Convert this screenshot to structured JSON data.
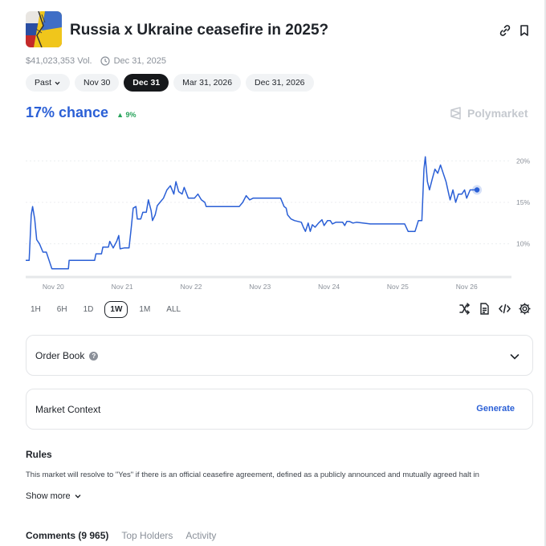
{
  "market": {
    "title": "Russia x Ukraine ceasefire in 2025?",
    "volume": "$41,023,353 Vol.",
    "end_date": "Dec 31, 2025"
  },
  "date_pills": [
    {
      "label": "Past",
      "active": false,
      "dropdown": true
    },
    {
      "label": "Nov 30",
      "active": false
    },
    {
      "label": "Dec 31",
      "active": true
    },
    {
      "label": "Mar 31, 2026",
      "active": false
    },
    {
      "label": "Dec 31, 2026",
      "active": false
    }
  ],
  "odds": {
    "chance": "17% chance",
    "delta": "9%",
    "brand": "Polymarket"
  },
  "chart_data": {
    "type": "line",
    "x_ticks": [
      "Nov 20",
      "Nov 21",
      "Nov 22",
      "Nov 23",
      "Nov 24",
      "Nov 25",
      "Nov 26"
    ],
    "y_ticks": [
      "20%",
      "15%",
      "10%"
    ],
    "ylim": [
      6,
      21
    ],
    "xlim": [
      0,
      7.05
    ],
    "line_color": "#2a5fd6",
    "points": [
      [
        0.0,
        8.0
      ],
      [
        0.05,
        8.0
      ],
      [
        0.08,
        13.5
      ],
      [
        0.1,
        14.5
      ],
      [
        0.13,
        13.0
      ],
      [
        0.16,
        10.5
      ],
      [
        0.2,
        10.0
      ],
      [
        0.25,
        9.0
      ],
      [
        0.3,
        9.0
      ],
      [
        0.38,
        7.0
      ],
      [
        0.55,
        7.0
      ],
      [
        0.62,
        7.0
      ],
      [
        0.63,
        8.0
      ],
      [
        0.9,
        8.0
      ],
      [
        1.0,
        8.0
      ],
      [
        1.02,
        8.8
      ],
      [
        1.1,
        8.8
      ],
      [
        1.12,
        9.6
      ],
      [
        1.2,
        9.6
      ],
      [
        1.22,
        10.3
      ],
      [
        1.27,
        9.5
      ],
      [
        1.32,
        10.3
      ],
      [
        1.35,
        11.0
      ],
      [
        1.37,
        9.4
      ],
      [
        1.43,
        9.5
      ],
      [
        1.5,
        9.5
      ],
      [
        1.53,
        11.8
      ],
      [
        1.56,
        14.3
      ],
      [
        1.6,
        14.5
      ],
      [
        1.62,
        13.0
      ],
      [
        1.67,
        13.0
      ],
      [
        1.7,
        13.8
      ],
      [
        1.75,
        13.8
      ],
      [
        1.78,
        15.3
      ],
      [
        1.82,
        14.0
      ],
      [
        1.84,
        12.8
      ],
      [
        1.88,
        13.5
      ],
      [
        1.91,
        14.6
      ],
      [
        1.95,
        15.0
      ],
      [
        2.0,
        15.5
      ],
      [
        2.05,
        16.5
      ],
      [
        2.1,
        17.0
      ],
      [
        2.15,
        16.0
      ],
      [
        2.18,
        17.5
      ],
      [
        2.22,
        16.3
      ],
      [
        2.27,
        16.0
      ],
      [
        2.3,
        16.8
      ],
      [
        2.36,
        15.5
      ],
      [
        2.45,
        15.5
      ],
      [
        2.5,
        16.0
      ],
      [
        2.55,
        15.3
      ],
      [
        2.6,
        15.0
      ],
      [
        2.62,
        14.5
      ],
      [
        2.8,
        14.5
      ],
      [
        3.1,
        14.5
      ],
      [
        3.15,
        15.0
      ],
      [
        3.2,
        15.8
      ],
      [
        3.25,
        15.3
      ],
      [
        3.3,
        15.5
      ],
      [
        3.35,
        15.5
      ],
      [
        3.7,
        15.5
      ],
      [
        3.75,
        14.5
      ],
      [
        3.78,
        14.3
      ],
      [
        3.8,
        13.5
      ],
      [
        3.85,
        13.0
      ],
      [
        3.9,
        12.8
      ],
      [
        4.0,
        12.6
      ],
      [
        4.03,
        12.0
      ],
      [
        4.06,
        11.5
      ],
      [
        4.1,
        12.5
      ],
      [
        4.13,
        11.5
      ],
      [
        4.16,
        12.3
      ],
      [
        4.2,
        12.0
      ],
      [
        4.25,
        12.5
      ],
      [
        4.3,
        12.9
      ],
      [
        4.33,
        12.2
      ],
      [
        4.38,
        12.8
      ],
      [
        4.42,
        12.8
      ],
      [
        4.45,
        12.4
      ],
      [
        4.5,
        12.6
      ],
      [
        4.6,
        12.6
      ],
      [
        4.63,
        12.2
      ],
      [
        4.66,
        12.7
      ],
      [
        4.7,
        12.7
      ],
      [
        4.75,
        12.5
      ],
      [
        4.8,
        12.6
      ],
      [
        5.0,
        12.4
      ],
      [
        5.2,
        12.4
      ],
      [
        5.5,
        12.4
      ],
      [
        5.55,
        11.5
      ],
      [
        5.65,
        11.5
      ],
      [
        5.7,
        12.8
      ],
      [
        5.75,
        12.8
      ],
      [
        5.78,
        19.0
      ],
      [
        5.8,
        20.5
      ],
      [
        5.83,
        17.5
      ],
      [
        5.86,
        16.5
      ],
      [
        5.9,
        17.8
      ],
      [
        5.94,
        19.0
      ],
      [
        5.98,
        18.5
      ],
      [
        6.02,
        19.5
      ],
      [
        6.06,
        18.5
      ],
      [
        6.1,
        17.5
      ],
      [
        6.14,
        16.0
      ],
      [
        6.16,
        15.3
      ],
      [
        6.2,
        16.5
      ],
      [
        6.24,
        15.0
      ],
      [
        6.28,
        16.0
      ],
      [
        6.33,
        16.0
      ],
      [
        6.37,
        16.5
      ],
      [
        6.4,
        15.5
      ],
      [
        6.45,
        16.5
      ],
      [
        6.5,
        16.5
      ],
      [
        6.55,
        16.5
      ]
    ]
  },
  "ranges": [
    {
      "label": "1H",
      "active": false
    },
    {
      "label": "6H",
      "active": false
    },
    {
      "label": "1D",
      "active": false
    },
    {
      "label": "1W",
      "active": true
    },
    {
      "label": "1M",
      "active": false
    },
    {
      "label": "ALL",
      "active": false
    }
  ],
  "order_book": {
    "label": "Order Book",
    "help": "?"
  },
  "market_context": {
    "label": "Market Context",
    "action": "Generate"
  },
  "rules": {
    "heading": "Rules",
    "text": "This market will resolve to \"Yes\" if there is an official ceasefire agreement, defined as a publicly announced and mutually agreed halt in",
    "show_more": "Show more"
  },
  "bottom_tabs": [
    {
      "label": "Comments (9 965)",
      "active": true
    },
    {
      "label": "Top Holders",
      "active": false
    },
    {
      "label": "Activity",
      "active": false
    }
  ]
}
